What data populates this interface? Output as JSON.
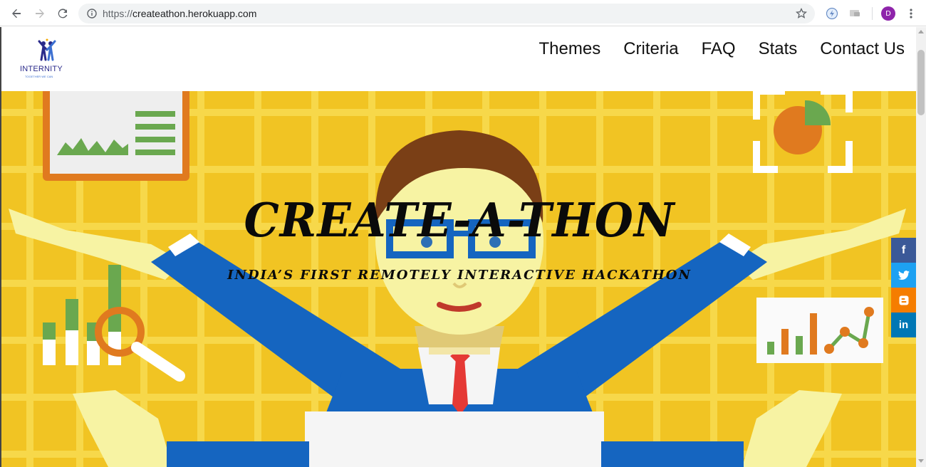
{
  "browser": {
    "url_scheme": "https://",
    "url_host": "createathon.herokuapp.com",
    "profile_initial": "D"
  },
  "site": {
    "logo_text": "INTERNITY",
    "logo_tagline": "TOGETHER WE CAN",
    "menu": [
      "Themes",
      "Criteria",
      "FAQ",
      "Stats",
      "Contact Us"
    ]
  },
  "hero": {
    "title": "CREATE-A-THON",
    "subtitle": "INDIA’S FIRST REMOTELY INTERACTIVE HACKATHON"
  },
  "share": [
    {
      "label": "f",
      "icon": "facebook-icon",
      "color": "#3b5998"
    },
    {
      "label": "",
      "icon": "twitter-icon",
      "color": "#1da1f2"
    },
    {
      "label": "B",
      "icon": "blogger-icon",
      "color": "#f57d00"
    },
    {
      "label": "in",
      "icon": "linkedin-icon",
      "color": "#0077b5"
    }
  ],
  "colors": {
    "hero_bg": "#f1c423",
    "accent_blue": "#1565c0"
  }
}
